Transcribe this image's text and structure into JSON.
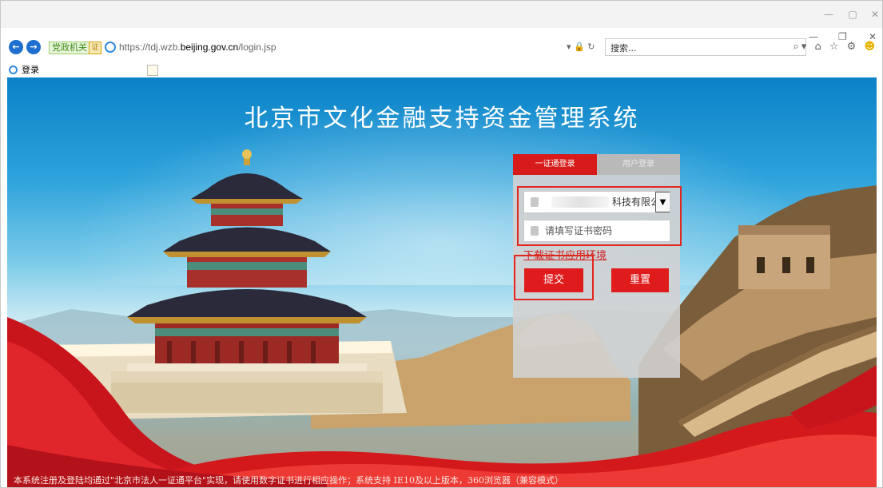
{
  "browser": {
    "url_prefix": "https://tdj.wzb.",
    "url_domain": "beijing.gov.cn",
    "url_path": "/login.jsp",
    "ext_label": "党政机关",
    "ext_badge": "证",
    "search_placeholder": "搜索...",
    "addr_tools": "▾ 🔒 ↻",
    "tab_title": "登录",
    "tab_close": "×"
  },
  "page": {
    "title": "北京市文化金融支持资金管理系统",
    "footer": "本系统注册及登陆均通过\"北京市法人一证通平台\"实现，请使用数字证书进行相应操作；系统支持 IE10及以上版本，360浏览器（兼容模式）"
  },
  "login": {
    "tabs": [
      {
        "label": "一证通登录",
        "active": true
      },
      {
        "label": "用户登录",
        "active": false
      }
    ],
    "cert_selected": "科技有限公",
    "password_placeholder": "请填写证书密码",
    "download_link": "下载证书应用环境",
    "submit_label": "提交",
    "reset_label": "重置"
  },
  "colors": {
    "accent_red": "#e01b1b",
    "highlight_red": "#e0281f",
    "sky_blue": "#0b82c8"
  }
}
